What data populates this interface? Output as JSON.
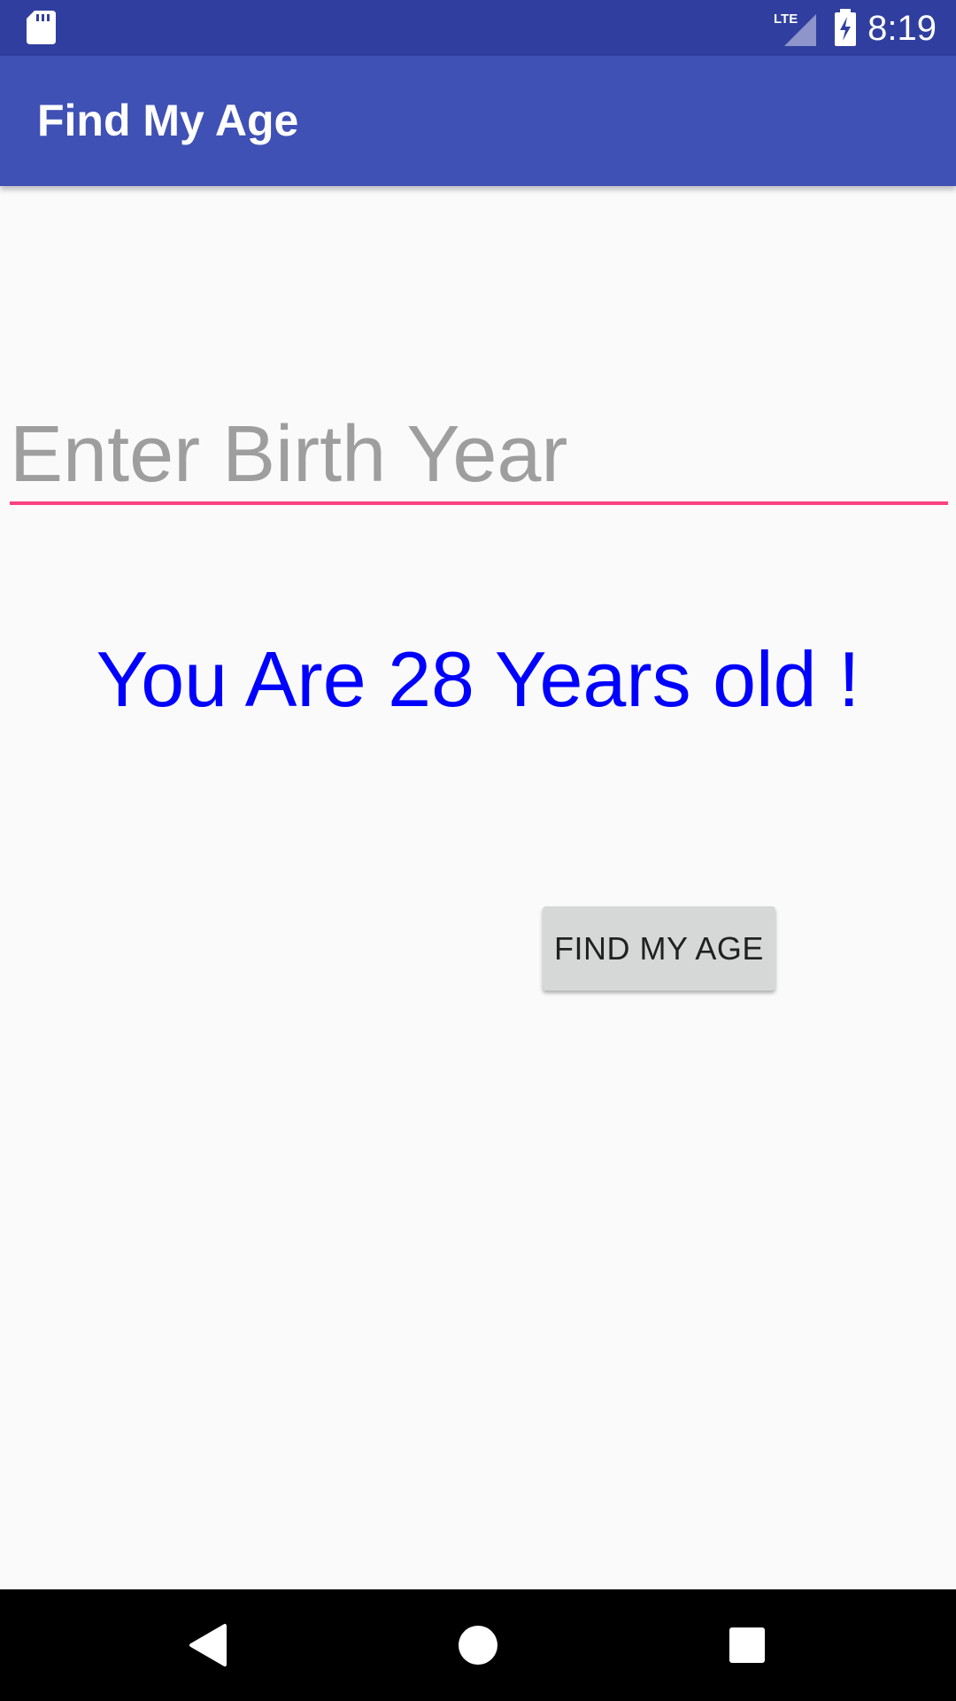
{
  "status_bar": {
    "time": "8:19",
    "network_label": "LTE",
    "icons": [
      "sd-card-icon",
      "signal-icon",
      "battery-charging-icon"
    ]
  },
  "app_bar": {
    "title": "Find My Age"
  },
  "form": {
    "birth_year_value": "",
    "birth_year_placeholder": "Enter Birth Year",
    "result_text": "You Are 28 Years old !",
    "button_label": "FIND MY AGE"
  },
  "nav_bar": {
    "icons": [
      "back-icon",
      "home-icon",
      "recents-icon"
    ]
  },
  "colors": {
    "status_bar": "#303f9f",
    "app_bar": "#3f51b5",
    "accent": "#ff4081",
    "result_text": "#0000ff",
    "button": "#d6d7d7",
    "background": "#fafafa"
  }
}
